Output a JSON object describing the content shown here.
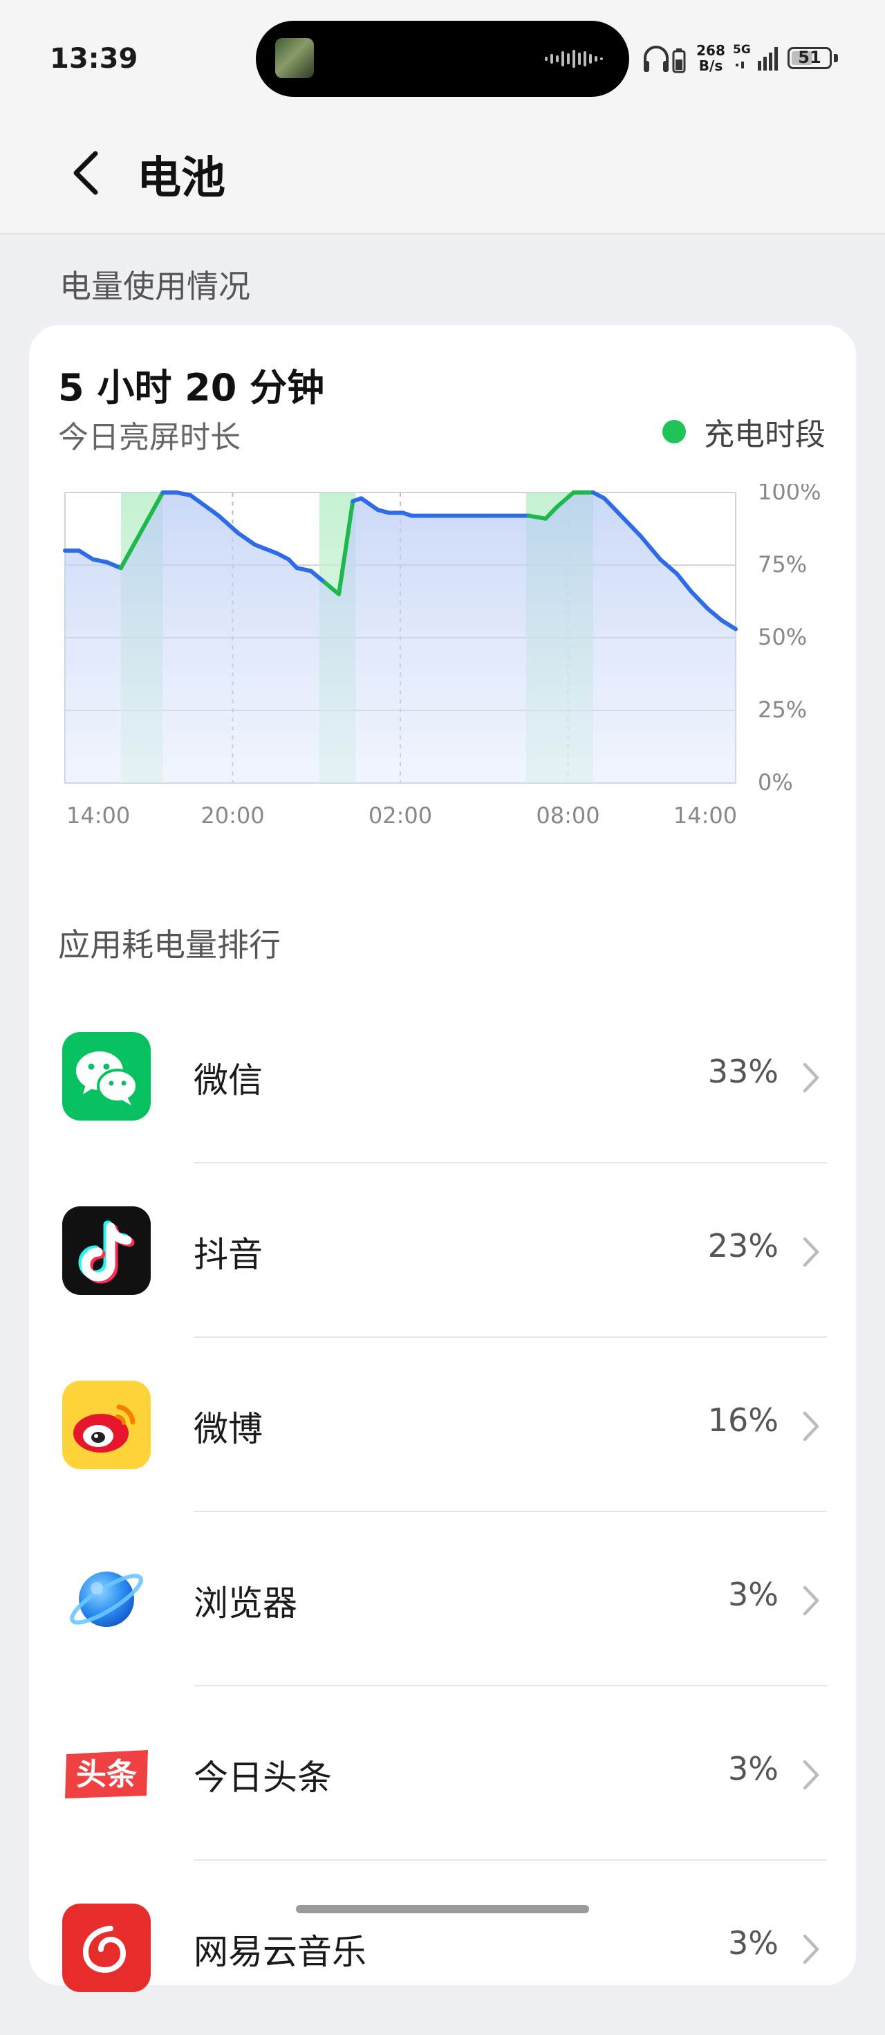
{
  "status_bar": {
    "time": "13:39",
    "net_speed_value": "268",
    "net_speed_unit": "B/s",
    "network_type": "5G",
    "battery_level": "51"
  },
  "header": {
    "title": "电池",
    "back_icon": "chevron-left-icon"
  },
  "usage_section": {
    "label": "电量使用情况",
    "screen_time": "5 小时 20 分钟",
    "screen_time_label": "今日亮屏时长",
    "legend_label": "充电时段",
    "legend_color": "#1ec455"
  },
  "chart_data": {
    "type": "line",
    "title": "",
    "xlabel": "",
    "ylabel": "",
    "x_tick_labels": [
      "14:00",
      "20:00",
      "02:00",
      "08:00",
      "14:00"
    ],
    "y_tick_labels": [
      "100%",
      "75%",
      "50%",
      "25%",
      "0%"
    ],
    "ylim": [
      0,
      100
    ],
    "x_unit": "hours since 14:00",
    "xlim": [
      0,
      24
    ],
    "series": [
      {
        "name": "",
        "color": "#2e6be6",
        "points": [
          [
            0,
            80
          ],
          [
            0.5,
            80
          ],
          [
            1,
            77
          ],
          [
            1.5,
            76
          ],
          [
            2,
            74
          ],
          [
            3.5,
            100
          ],
          [
            4,
            100
          ],
          [
            4.5,
            99
          ],
          [
            5.5,
            92
          ],
          [
            6.2,
            86
          ],
          [
            6.8,
            82
          ],
          [
            7.6,
            79
          ],
          [
            8,
            77
          ],
          [
            8.3,
            74
          ],
          [
            8.8,
            73
          ],
          [
            9.3,
            69
          ],
          [
            9.8,
            65
          ],
          [
            10.3,
            97
          ],
          [
            10.6,
            98
          ],
          [
            11.2,
            94
          ],
          [
            11.6,
            93
          ],
          [
            12.1,
            93
          ],
          [
            12.4,
            92
          ],
          [
            13,
            92
          ],
          [
            15,
            92
          ],
          [
            16.6,
            92
          ],
          [
            17.2,
            91
          ],
          [
            17.6,
            95
          ],
          [
            18.2,
            100
          ],
          [
            18.5,
            100
          ],
          [
            18.9,
            100
          ],
          [
            19.3,
            98
          ],
          [
            20,
            91
          ],
          [
            20.6,
            85
          ],
          [
            21.3,
            77
          ],
          [
            21.9,
            72
          ],
          [
            22.4,
            66
          ],
          [
            23,
            60
          ],
          [
            23.5,
            56
          ],
          [
            24,
            53
          ]
        ]
      }
    ],
    "charging_periods": [
      [
        2,
        3.5
      ],
      [
        9.1,
        10.4
      ],
      [
        16.5,
        18.9
      ]
    ],
    "grid": true
  },
  "app_ranking": {
    "title": "应用耗电量排行",
    "apps": [
      {
        "name": "微信",
        "percent": "33%",
        "icon": "wechat-icon"
      },
      {
        "name": "抖音",
        "percent": "23%",
        "icon": "douyin-icon"
      },
      {
        "name": "微博",
        "percent": "16%",
        "icon": "weibo-icon"
      },
      {
        "name": "浏览器",
        "percent": "3%",
        "icon": "browser-icon"
      },
      {
        "name": "今日头条",
        "percent": "3%",
        "icon": "toutiao-icon"
      },
      {
        "name": "网易云音乐",
        "percent": "3%",
        "icon": "netease-music-icon"
      }
    ]
  }
}
